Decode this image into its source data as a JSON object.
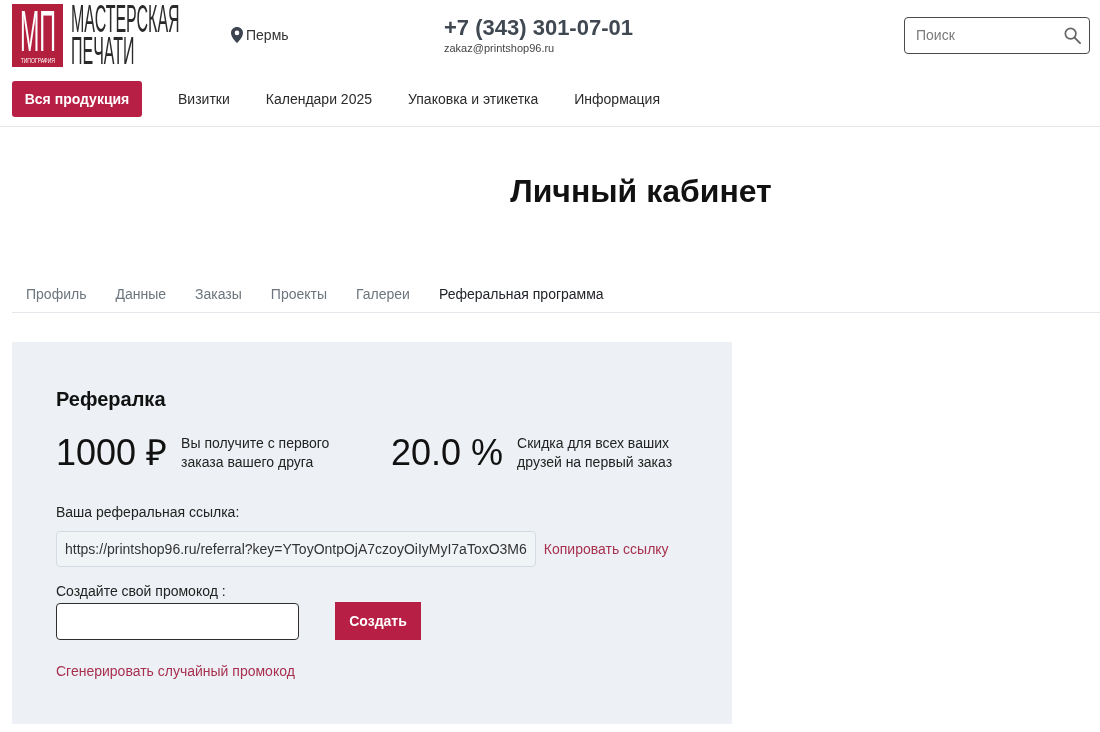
{
  "header": {
    "logo": {
      "monogram": "МП",
      "caption": "ТИПОГРАФИЯ",
      "name_lines": [
        "МАСТЕРСКАЯ",
        "ПЕЧАТИ"
      ]
    },
    "city": "Пермь",
    "phone": "+7 (343) 301-07-01",
    "email": "zakaz@printshop96.ru",
    "search": {
      "placeholder": "Поиск"
    }
  },
  "nav": {
    "catalog_button": "Вся продукция",
    "links": [
      "Визитки",
      "Календари 2025",
      "Упаковка и этикетка",
      "Информация"
    ]
  },
  "page_title": "Личный кабинет",
  "tabs": [
    {
      "label": "Профиль",
      "selected": false
    },
    {
      "label": "Данные",
      "selected": false
    },
    {
      "label": "Заказы",
      "selected": false
    },
    {
      "label": "Проекты",
      "selected": false
    },
    {
      "label": "Галереи",
      "selected": false
    },
    {
      "label": "Реферальная программа",
      "selected": true
    }
  ],
  "referral": {
    "title": "Рефералка",
    "stats": [
      {
        "value": "1000 ₽",
        "description": "Вы получите с первого заказа вашего друга"
      },
      {
        "value": "20.0 %",
        "description": "Скидка для всех ваших друзей на первый заказ"
      }
    ],
    "link_label": "Ваша реферальная ссылка:",
    "link_value": "https://printshop96.ru/referral?key=YToyOntpOjA7czoyOiIyMyI7aToxO3M6",
    "copy_link": "Копировать ссылку",
    "promo_label": "Создайте свой промокод :",
    "create_button": "Создать",
    "generate_link": "Сгенерировать случайный промокод"
  }
}
